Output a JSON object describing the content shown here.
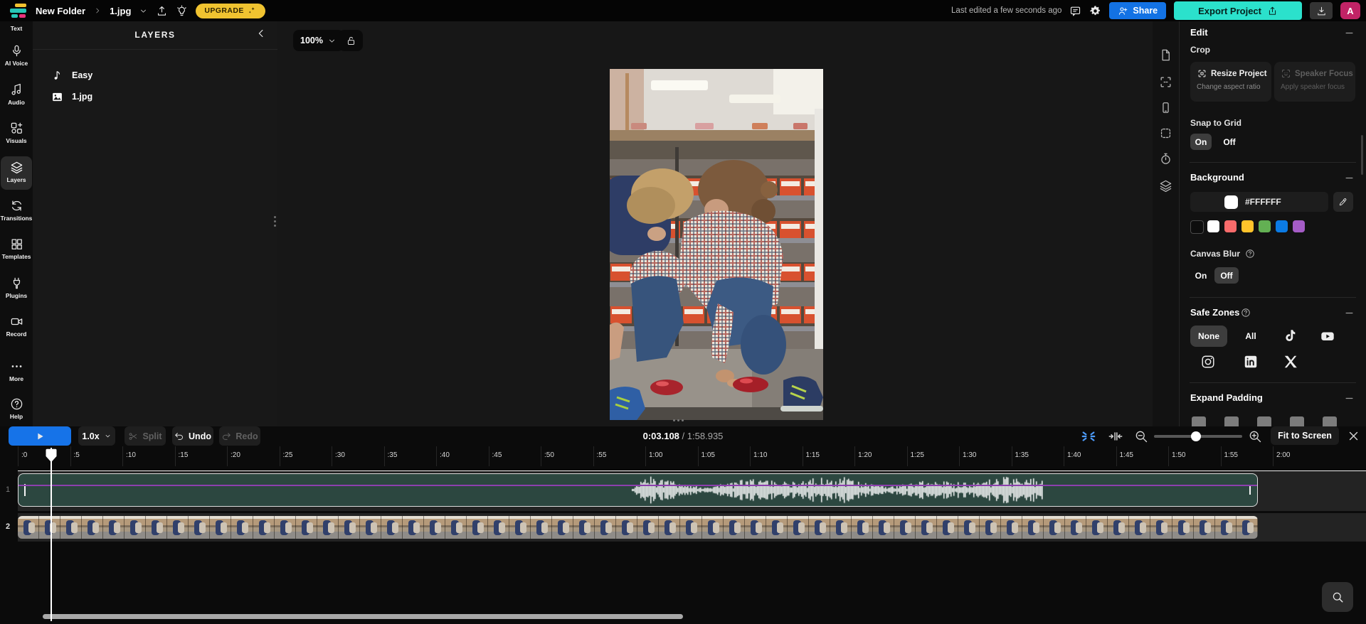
{
  "topbar": {
    "folder": "New Folder",
    "file": "1.jpg",
    "upgrade": "UPGRADE",
    "last_edited": "Last edited a few seconds ago",
    "share": "Share",
    "export": "Export Project",
    "avatar_initial": "A",
    "colors": {
      "share_blue": "#1372E4",
      "export_teal": "#2BE1CC",
      "upgrade_yellow": "#F0C330",
      "avatar_pink": "#C12366",
      "play_blue": "#1673E8"
    }
  },
  "sidebar": {
    "items": [
      {
        "label": "Text",
        "icon": null
      },
      {
        "label": "AI Voice",
        "icon": "ai-voice-icon"
      },
      {
        "label": "Audio",
        "icon": "audio-icon"
      },
      {
        "label": "Visuals",
        "icon": "visuals-icon"
      },
      {
        "label": "Layers",
        "icon": "layers-icon",
        "active": true
      },
      {
        "label": "Transitions",
        "icon": "transitions-icon"
      },
      {
        "label": "Templates",
        "icon": "templates-icon"
      },
      {
        "label": "Plugins",
        "icon": "plugins-icon"
      },
      {
        "label": "Record",
        "icon": "record-icon"
      },
      {
        "label": "More",
        "icon": "more-icon"
      },
      {
        "label": "Help",
        "icon": "help-icon"
      }
    ]
  },
  "layers_panel": {
    "title": "LAYERS",
    "items": [
      {
        "label": "Easy",
        "icon": "music-note-icon"
      },
      {
        "label": "1.jpg",
        "icon": "image-icon"
      }
    ]
  },
  "canvas": {
    "zoom_level": "100%"
  },
  "right_strip": {
    "icons": [
      "file-icon",
      "canvas-frame-icon",
      "phone-icon",
      "border-icon",
      "timer-icon",
      "stack-icon"
    ]
  },
  "right_panel": {
    "edit": {
      "title": "Edit",
      "section": "Crop",
      "resize_title": "Resize Project",
      "resize_subtitle": "Change aspect ratio",
      "speaker_title": "Speaker Focus",
      "speaker_subtitle": "Apply speaker focus",
      "snap_label": "Snap to Grid",
      "on": "On",
      "off": "Off"
    },
    "background": {
      "title": "Background",
      "hex": "#FFFFFF",
      "swatches": [
        "#0d0d0d",
        "#FFFFFF",
        "#F96B6B",
        "#FFC32B",
        "#63B053",
        "#0B7BE4",
        "#A55CC6"
      ],
      "canvas_blur": "Canvas Blur",
      "on": "On",
      "off": "Off"
    },
    "safe_zones": {
      "title": "Safe Zones",
      "none": "None",
      "all": "All",
      "platform_icons": [
        "tiktok-icon",
        "youtube-icon",
        "instagram-icon",
        "linkedin-icon",
        "x-icon"
      ]
    },
    "expand_padding": {
      "title": "Expand Padding",
      "preset_icons": [
        "padding-preset-icon",
        "padding-preset-icon",
        "padding-preset-icon",
        "padding-preset-icon",
        "padding-preset-icon"
      ]
    }
  },
  "timeline": {
    "speed": "1.0x",
    "split": "Split",
    "undo": "Undo",
    "redo": "Redo",
    "current_time": "0:03.108",
    "separator": "/",
    "total_time": "1:58.935",
    "fit_to_screen": "Fit to Screen",
    "ruler_labels": [
      ":0",
      ":5",
      ":10",
      ":15",
      ":20",
      ":25",
      ":30",
      ":35",
      ":40",
      ":45",
      ":50",
      ":55",
      "1:00",
      "1:05",
      "1:10",
      "1:15",
      "1:20",
      "1:25",
      "1:30",
      "1:35",
      "1:40",
      "1:45",
      "1:50",
      "1:55",
      "2:00"
    ],
    "tracks": [
      {
        "number": "1",
        "type": "audio"
      },
      {
        "number": "2",
        "type": "video"
      }
    ]
  }
}
